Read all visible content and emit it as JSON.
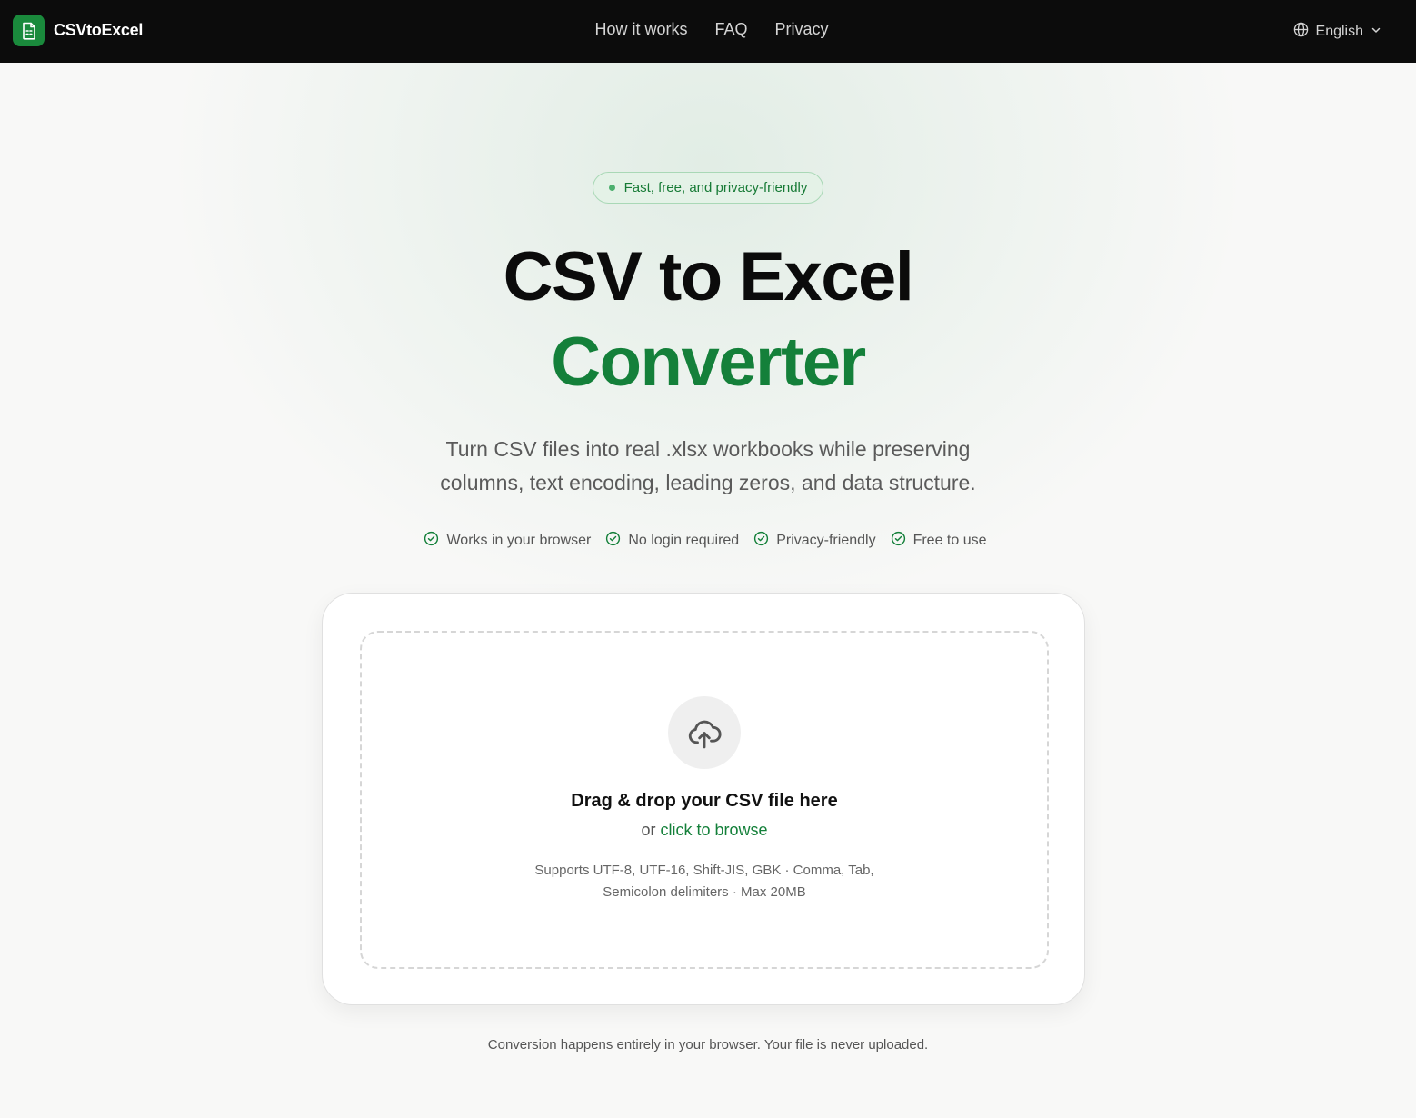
{
  "header": {
    "brand_name": "CSVtoExcel",
    "nav": [
      "How it works",
      "FAQ",
      "Privacy"
    ],
    "language": "English",
    "background_color": "#0c0c0c"
  },
  "hero": {
    "badge": "Fast, free, and privacy-friendly",
    "title_line1": "CSV to Excel",
    "title_line2": "Converter",
    "subtitle": "Turn CSV files into real .xlsx workbooks while preserving columns, text encoding, leading zeros, and data structure.",
    "features": [
      "Works in your browser",
      "No login required",
      "Privacy-friendly",
      "Free to use"
    ]
  },
  "upload": {
    "title": "Drag & drop your CSV file here",
    "or": "or",
    "browse": "click to browse",
    "note": "Supports UTF-8, UTF-16, Shift-JIS, GBK · Comma, Tab, Semicolon delimiters · Max 20MB"
  },
  "footnote": "Conversion happens entirely in your browser. Your file is never uploaded.",
  "colors": {
    "accent": "#14803a",
    "badge_bg": "#e4f2e7",
    "page_bg": "#f8f8f7"
  },
  "icons": {
    "logo": "spreadsheet-file-icon",
    "language": "globe-icon",
    "dropdown": "chevron-down-icon",
    "feature": "check-circle-icon",
    "upload": "cloud-upload-icon"
  }
}
